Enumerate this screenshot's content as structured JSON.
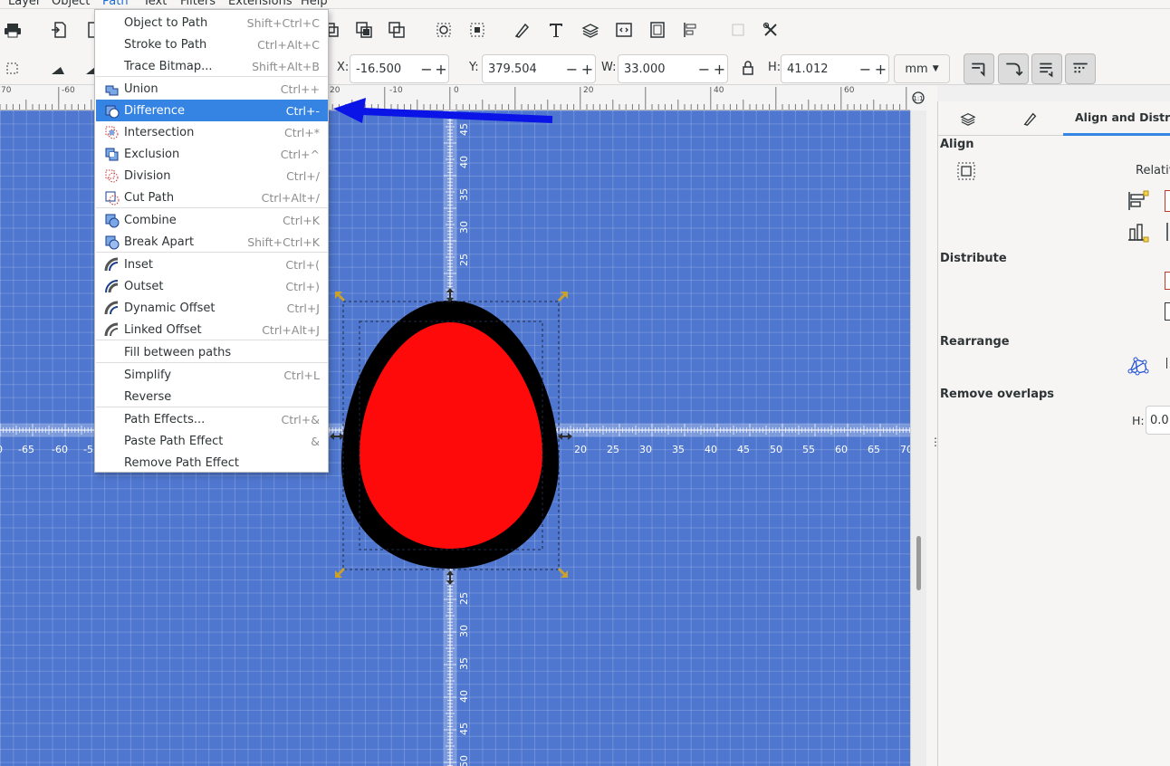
{
  "menubar": {
    "items": [
      "Layer",
      "Object",
      "Path",
      "Text",
      "Filters",
      "Extensions",
      "Help"
    ],
    "active": "Path"
  },
  "toolbar": {
    "x_label": "X:",
    "x_value": "-16.500",
    "y_label": "Y:",
    "y_value": "379.504",
    "w_label": "W:",
    "w_value": "33.000",
    "h_label": "H:",
    "h_value": "41.012",
    "unit": "mm",
    "minus": "−",
    "plus": "+"
  },
  "path_menu": {
    "items": [
      {
        "label": "Object to Path",
        "shortcut": "Shift+Ctrl+C",
        "icon": "none"
      },
      {
        "label": "Stroke to Path",
        "shortcut": "Ctrl+Alt+C",
        "icon": "none"
      },
      {
        "label": "Trace Bitmap...",
        "shortcut": "Shift+Alt+B",
        "icon": "none"
      },
      {
        "label": "Union",
        "shortcut": "Ctrl++",
        "icon": "union-icon"
      },
      {
        "label": "Difference",
        "shortcut": "Ctrl+-",
        "icon": "difference-icon"
      },
      {
        "label": "Intersection",
        "shortcut": "Ctrl+*",
        "icon": "intersection-icon"
      },
      {
        "label": "Exclusion",
        "shortcut": "Ctrl+^",
        "icon": "exclusion-icon"
      },
      {
        "label": "Division",
        "shortcut": "Ctrl+/",
        "icon": "division-icon"
      },
      {
        "label": "Cut Path",
        "shortcut": "Ctrl+Alt+/",
        "icon": "cut-path-icon"
      },
      {
        "label": "Combine",
        "shortcut": "Ctrl+K",
        "icon": "combine-icon"
      },
      {
        "label": "Break Apart",
        "shortcut": "Shift+Ctrl+K",
        "icon": "break-apart-icon"
      },
      {
        "label": "Inset",
        "shortcut": "Ctrl+(",
        "icon": "inset-icon"
      },
      {
        "label": "Outset",
        "shortcut": "Ctrl+)",
        "icon": "outset-icon"
      },
      {
        "label": "Dynamic Offset",
        "shortcut": "Ctrl+J",
        "icon": "dynamic-offset-icon"
      },
      {
        "label": "Linked Offset",
        "shortcut": "Ctrl+Alt+J",
        "icon": "linked-offset-icon"
      },
      {
        "label": "Fill between paths",
        "shortcut": "",
        "icon": "none"
      },
      {
        "label": "Simplify",
        "shortcut": "Ctrl+L",
        "icon": "none"
      },
      {
        "label": "Reverse",
        "shortcut": "",
        "icon": "none"
      },
      {
        "label": "Path Effects...",
        "shortcut": "Ctrl+&",
        "icon": "none"
      },
      {
        "label": "Paste Path Effect",
        "shortcut": "&",
        "icon": "none"
      },
      {
        "label": "Remove Path Effect",
        "shortcut": "",
        "icon": "none"
      }
    ],
    "highlighted": "Difference"
  },
  "hruler": {
    "ticks": [
      "70",
      "-60",
      "-10",
      "0",
      "20",
      "40",
      "60"
    ],
    "tick_prefix": "20"
  },
  "canvas_axis": {
    "h_labels": [
      "0",
      "-65",
      "-60",
      "-55",
      "20",
      "25",
      "30",
      "35",
      "40",
      "45",
      "50",
      "55",
      "60",
      "65",
      "70"
    ],
    "v_labels_top": [
      "45",
      "40",
      "35",
      "30",
      "25"
    ],
    "v_labels_bottom": [
      "25",
      "30",
      "35",
      "40",
      "45",
      "50"
    ]
  },
  "panel": {
    "active_tab": "Align and Distribute",
    "align_heading": "Align",
    "relative_label": "Relativ",
    "distribute_heading": "Distribute",
    "rearrange_heading": "Rearrange",
    "remove_overlaps_heading": "Remove overlaps",
    "h_label": "H:",
    "h_value": "0.0"
  },
  "colors": {
    "canvas": "#4f77cf",
    "egg_fill": "#ff0a0a",
    "egg_stroke": "#000000",
    "menu_highlight": "#3584e4",
    "arrow": "#0a14e6"
  }
}
